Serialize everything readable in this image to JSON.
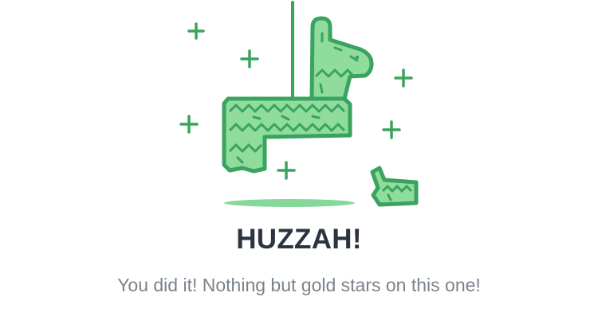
{
  "empty_state": {
    "illustration_icon": "pinata-icon",
    "title": "HUZZAH!",
    "message": "You did it! Nothing but gold stars on this one!"
  },
  "colors": {
    "outline": "#3aa35f",
    "fill": "#8fdc9c",
    "shadow": "#86d89a",
    "title": "#2b3440",
    "message": "#7a838c"
  }
}
